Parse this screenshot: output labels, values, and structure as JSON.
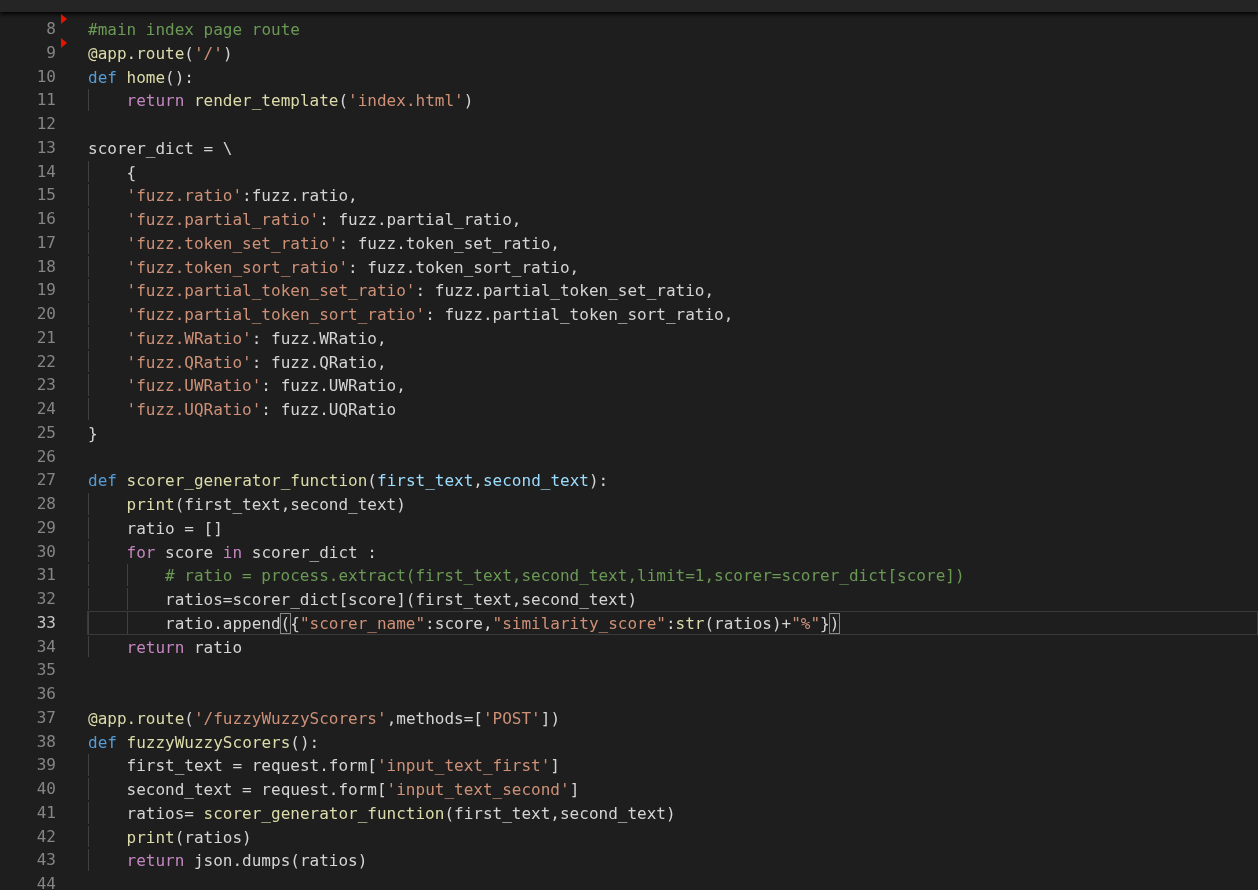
{
  "editor": {
    "lines": [
      {
        "n": "8",
        "marked": true,
        "current": false,
        "tokens": [
          {
            "kind": "comment",
            "text": "#main index page route"
          }
        ]
      },
      {
        "n": "9",
        "marked": true,
        "current": false,
        "tokens": [
          {
            "kind": "function",
            "text": "@app.route"
          },
          {
            "kind": "plain",
            "text": "("
          },
          {
            "kind": "string",
            "text": "'/'"
          },
          {
            "kind": "plain",
            "text": ")"
          }
        ]
      },
      {
        "n": "10",
        "marked": false,
        "current": false,
        "tokens": [
          {
            "kind": "keyword",
            "text": "def "
          },
          {
            "kind": "function",
            "text": "home"
          },
          {
            "kind": "plain",
            "text": "():"
          }
        ],
        "children": [
          {
            "n": "11",
            "marked": false,
            "current": false,
            "tokens": [
              {
                "kind": "control",
                "text": "return "
              },
              {
                "kind": "function",
                "text": "render_template"
              },
              {
                "kind": "plain",
                "text": "("
              },
              {
                "kind": "string",
                "text": "'index.html'"
              },
              {
                "kind": "plain",
                "text": ")"
              }
            ]
          }
        ]
      },
      {
        "n": "12",
        "marked": false,
        "current": false
      },
      {
        "n": "13",
        "marked": false,
        "current": false,
        "tokens": [
          {
            "kind": "plain",
            "text": "scorer_dict = \\"
          }
        ],
        "children": [
          {
            "n": "14",
            "marked": false,
            "current": false,
            "tokens": [
              {
                "kind": "plain",
                "text": "{"
              }
            ]
          },
          {
            "n": "15",
            "marked": false,
            "current": false,
            "tokens": [
              {
                "kind": "string",
                "text": "'fuzz.ratio'"
              },
              {
                "kind": "plain",
                "text": ":fuzz.ratio,"
              }
            ]
          },
          {
            "n": "16",
            "marked": false,
            "current": false,
            "tokens": [
              {
                "kind": "string",
                "text": "'fuzz.partial_ratio'"
              },
              {
                "kind": "plain",
                "text": ": fuzz.partial_ratio,"
              }
            ]
          },
          {
            "n": "17",
            "marked": false,
            "current": false,
            "tokens": [
              {
                "kind": "string",
                "text": "'fuzz.token_set_ratio'"
              },
              {
                "kind": "plain",
                "text": ": fuzz.token_set_ratio,"
              }
            ]
          },
          {
            "n": "18",
            "marked": false,
            "current": false,
            "tokens": [
              {
                "kind": "string",
                "text": "'fuzz.token_sort_ratio'"
              },
              {
                "kind": "plain",
                "text": ": fuzz.token_sort_ratio,"
              }
            ]
          },
          {
            "n": "19",
            "marked": false,
            "current": false,
            "tokens": [
              {
                "kind": "string",
                "text": "'fuzz.partial_token_set_ratio'"
              },
              {
                "kind": "plain",
                "text": ": fuzz.partial_token_set_ratio,"
              }
            ]
          },
          {
            "n": "20",
            "marked": false,
            "current": false,
            "tokens": [
              {
                "kind": "string",
                "text": "'fuzz.partial_token_sort_ratio'"
              },
              {
                "kind": "plain",
                "text": ": fuzz.partial_token_sort_ratio,"
              }
            ]
          },
          {
            "n": "21",
            "marked": false,
            "current": false,
            "tokens": [
              {
                "kind": "string",
                "text": "'fuzz.WRatio'"
              },
              {
                "kind": "plain",
                "text": ": fuzz.WRatio,"
              }
            ]
          },
          {
            "n": "22",
            "marked": false,
            "current": false,
            "tokens": [
              {
                "kind": "string",
                "text": "'fuzz.QRatio'"
              },
              {
                "kind": "plain",
                "text": ": fuzz.QRatio,"
              }
            ]
          },
          {
            "n": "23",
            "marked": false,
            "current": false,
            "tokens": [
              {
                "kind": "string",
                "text": "'fuzz.UWRatio'"
              },
              {
                "kind": "plain",
                "text": ": fuzz.UWRatio,"
              }
            ]
          },
          {
            "n": "24",
            "marked": false,
            "current": false,
            "tokens": [
              {
                "kind": "string",
                "text": "'fuzz.UQRatio'"
              },
              {
                "kind": "plain",
                "text": ": fuzz.UQRatio"
              }
            ]
          }
        ]
      },
      {
        "n": "25",
        "marked": false,
        "current": false,
        "tokens": [
          {
            "kind": "plain",
            "text": "}"
          }
        ]
      },
      {
        "n": "26",
        "marked": false,
        "current": false
      },
      {
        "n": "27",
        "marked": false,
        "current": false,
        "tokens": [
          {
            "kind": "keyword",
            "text": "def "
          },
          {
            "kind": "function",
            "text": "scorer_generator_function"
          },
          {
            "kind": "plain",
            "text": "("
          },
          {
            "kind": "param",
            "text": "first_text"
          },
          {
            "kind": "plain",
            "text": ","
          },
          {
            "kind": "param",
            "text": "second_text"
          },
          {
            "kind": "plain",
            "text": "):"
          }
        ],
        "children": [
          {
            "n": "28",
            "marked": false,
            "current": false,
            "tokens": [
              {
                "kind": "function",
                "text": "print"
              },
              {
                "kind": "plain",
                "text": "(first_text,second_text)"
              }
            ]
          },
          {
            "n": "29",
            "marked": false,
            "current": false,
            "tokens": [
              {
                "kind": "plain",
                "text": "ratio = []"
              }
            ]
          },
          {
            "n": "30",
            "marked": false,
            "current": false,
            "tokens": [
              {
                "kind": "control",
                "text": "for"
              },
              {
                "kind": "plain",
                "text": " score "
              },
              {
                "kind": "control",
                "text": "in"
              },
              {
                "kind": "plain",
                "text": " scorer_dict :"
              }
            ],
            "children": [
              {
                "n": "31",
                "marked": false,
                "current": false,
                "tokens": [
                  {
                    "kind": "comment",
                    "text": "# ratio = process.extract(first_text,second_text,limit=1,scorer=scorer_dict[score])"
                  }
                ]
              },
              {
                "n": "32",
                "marked": false,
                "current": false,
                "tokens": [
                  {
                    "kind": "plain",
                    "text": "ratios=scorer_dict[score](first_text,second_text)"
                  }
                ]
              },
              {
                "n": "33",
                "marked": false,
                "current": true,
                "tokens": [
                  {
                    "kind": "plain",
                    "text": "ratio.append"
                  },
                  {
                    "kind": "bracket",
                    "text": "("
                  },
                  {
                    "kind": "plain",
                    "text": "{"
                  },
                  {
                    "kind": "string",
                    "text": "\"scorer_name\""
                  },
                  {
                    "kind": "plain",
                    "text": ":score,"
                  },
                  {
                    "kind": "string",
                    "text": "\"similarity_score\""
                  },
                  {
                    "kind": "plain",
                    "text": ":"
                  },
                  {
                    "kind": "function",
                    "text": "str"
                  },
                  {
                    "kind": "plain",
                    "text": "(ratios)+"
                  },
                  {
                    "kind": "string",
                    "text": "\"%\""
                  },
                  {
                    "kind": "plain",
                    "text": "}"
                  },
                  {
                    "kind": "bracket",
                    "text": ")"
                  }
                ]
              }
            ]
          },
          {
            "n": "34",
            "marked": false,
            "current": false,
            "tokens": [
              {
                "kind": "control",
                "text": "return"
              },
              {
                "kind": "plain",
                "text": " ratio"
              }
            ]
          }
        ]
      },
      {
        "n": "35",
        "marked": false,
        "current": false
      },
      {
        "n": "36",
        "marked": false,
        "current": false
      },
      {
        "n": "37",
        "marked": false,
        "current": false,
        "tokens": [
          {
            "kind": "function",
            "text": "@app.route"
          },
          {
            "kind": "plain",
            "text": "("
          },
          {
            "kind": "string",
            "text": "'/fuzzyWuzzyScorers'"
          },
          {
            "kind": "plain",
            "text": ",methods=["
          },
          {
            "kind": "string",
            "text": "'POST'"
          },
          {
            "kind": "plain",
            "text": "])"
          }
        ]
      },
      {
        "n": "38",
        "marked": false,
        "current": false,
        "tokens": [
          {
            "kind": "keyword",
            "text": "def "
          },
          {
            "kind": "function",
            "text": "fuzzyWuzzyScorers"
          },
          {
            "kind": "plain",
            "text": "():"
          }
        ],
        "children": [
          {
            "n": "39",
            "marked": false,
            "current": false,
            "tokens": [
              {
                "kind": "plain",
                "text": "first_text = request.form["
              },
              {
                "kind": "string",
                "text": "'input_text_first'"
              },
              {
                "kind": "plain",
                "text": "]"
              }
            ]
          },
          {
            "n": "40",
            "marked": false,
            "current": false,
            "tokens": [
              {
                "kind": "plain",
                "text": "second_text = request.form["
              },
              {
                "kind": "string",
                "text": "'input_text_second'"
              },
              {
                "kind": "plain",
                "text": "]"
              }
            ]
          },
          {
            "n": "41",
            "marked": false,
            "current": false,
            "tokens": [
              {
                "kind": "plain",
                "text": "ratios= "
              },
              {
                "kind": "function",
                "text": "scorer_generator_function"
              },
              {
                "kind": "plain",
                "text": "(first_text,second_text)"
              }
            ]
          },
          {
            "n": "42",
            "marked": false,
            "current": false,
            "tokens": [
              {
                "kind": "function",
                "text": "print"
              },
              {
                "kind": "plain",
                "text": "(ratios)"
              }
            ]
          },
          {
            "n": "43",
            "marked": false,
            "current": false,
            "tokens": [
              {
                "kind": "control",
                "text": "return"
              },
              {
                "kind": "plain",
                "text": " json.dumps(ratios)"
              }
            ]
          }
        ]
      },
      {
        "n": "44",
        "marked": false,
        "current": false
      }
    ]
  }
}
